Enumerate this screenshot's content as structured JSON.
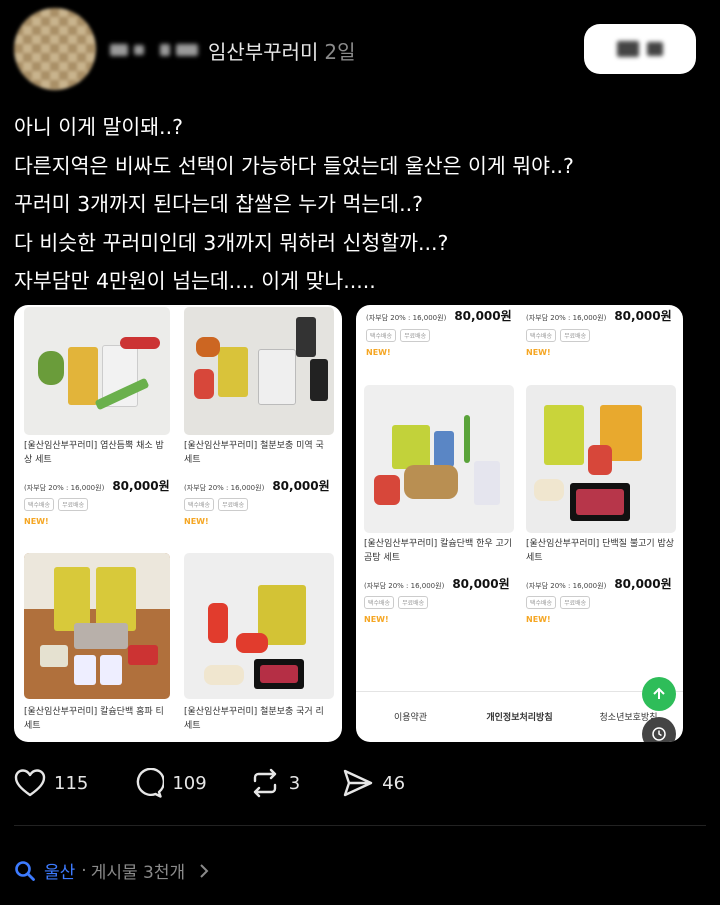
{
  "header": {
    "board": "임산부꾸러미",
    "time": "2일"
  },
  "post_lines": [
    "아니 이게 말이돼..?",
    "다른지역은 비싸도 선택이 가능하다 들었는데 울산은 이게 뭐야..?",
    "꾸러미 3개까지 된다는데 찹쌀은 누가 먹는데..?",
    "다 비슷한 꾸러미인데 3개까지 뭐하러 신청할까...?",
    "자부담만 4만원이 넘는데.... 이게 맞나....."
  ],
  "common": {
    "copay": "(자부담 20% : 16,000원)",
    "price": "80,000원",
    "tag1": "택수배송",
    "tag2": "무료배송",
    "badge": "NEW!"
  },
  "left_products": [
    {
      "name": "[울산임산부꾸러미] 엽산듬뿍 채소 밥상 세트"
    },
    {
      "name": "[울산임산부꾸러미] 철분보충 미역 국 세트"
    },
    {
      "name": "[울산임산부꾸러미] 칼슘단백 홈파 티 세트"
    },
    {
      "name": "[울산임산부꾸러미] 철분보충 국거 리 세트"
    }
  ],
  "right_products": [
    {
      "name": "[울산임산부꾸러미] 칼슘단백 한우 고기곰탕 세트"
    },
    {
      "name": "[울산임산부꾸러미] 단백질 불고기 밥상 세트"
    }
  ],
  "footer_links": [
    "이용약관",
    "개인정보처리방침",
    "청소년보호방침"
  ],
  "stats": {
    "likes": "115",
    "comments": "109",
    "reposts": "3",
    "shares": "46"
  },
  "topic": {
    "name": "울산",
    "separator": "·",
    "count": "게시물 3천개"
  },
  "colors": {
    "accent": "#3d7bff",
    "new_badge": "#f5a623",
    "fab": "#2ebd59"
  }
}
